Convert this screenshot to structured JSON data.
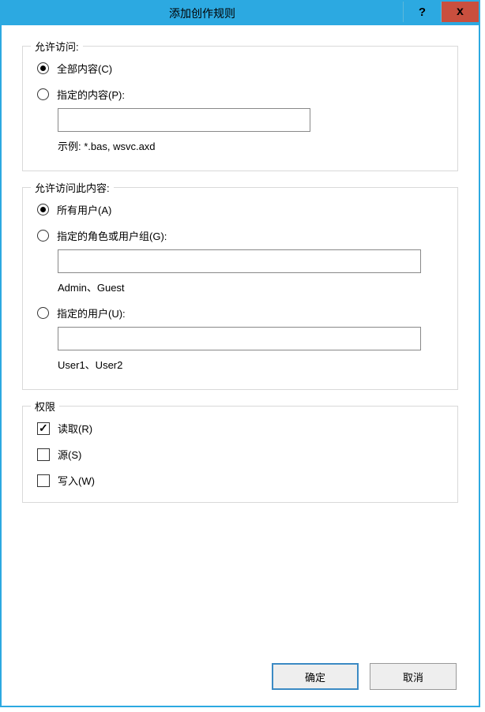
{
  "titlebar": {
    "title": "添加创作规则",
    "help_symbol": "?",
    "close_symbol": "x"
  },
  "access_section": {
    "legend": "允许访问:",
    "radio_all_content": "全部内容(C)",
    "radio_specified_content": "指定的内容(P):",
    "content_input": "",
    "example_label": "示例: *.bas, wsvc.axd"
  },
  "who_section": {
    "legend": "允许访问此内容:",
    "radio_all_users": "所有用户(A)",
    "radio_roles_groups": "指定的角色或用户组(G):",
    "roles_input": "",
    "roles_example": "Admin、Guest",
    "radio_users": "指定的用户(U):",
    "users_input": "",
    "users_example": "User1、User2"
  },
  "permissions_section": {
    "legend": "权限",
    "read": "读取(R)",
    "source": "源(S)",
    "write": "写入(W)"
  },
  "buttons": {
    "ok": "确定",
    "cancel": "取消"
  }
}
